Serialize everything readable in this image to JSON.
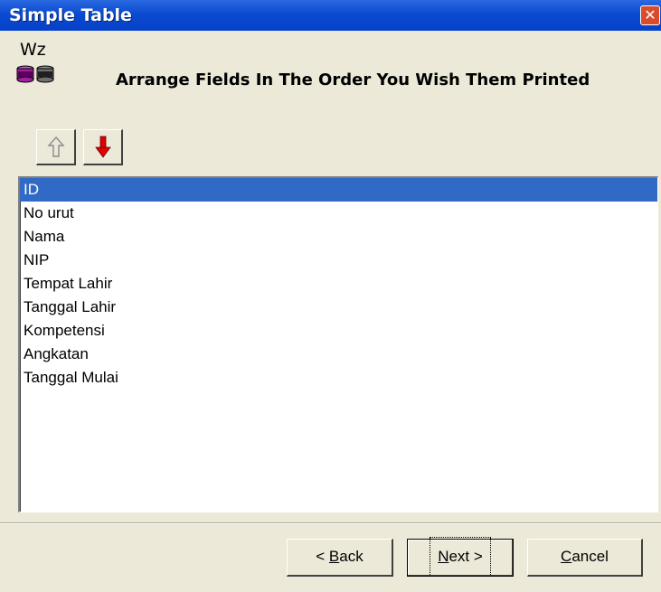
{
  "window": {
    "title": "Simple Table",
    "close_symbol": "✕"
  },
  "header": {
    "wz_label": "Wz",
    "icon": "view-abc-wizard-icon",
    "title": "Arrange Fields In The Order You Wish Them Printed"
  },
  "toolbar": {
    "move_up_icon": "arrow-up-outline-icon",
    "move_down_icon": "arrow-down-red-icon"
  },
  "fields": {
    "selected_index": 0,
    "items": [
      "ID",
      "No urut",
      "Nama",
      "NIP",
      "Tempat Lahir",
      "Tanggal Lahir",
      "Kompetensi",
      "Angkatan",
      "Tanggal Mulai"
    ]
  },
  "buttons": {
    "back": {
      "pre": "< ",
      "mnemonic": "B",
      "post": "ack"
    },
    "next": {
      "pre": "",
      "mnemonic": "N",
      "post": "ext >"
    },
    "cancel": {
      "pre": "",
      "mnemonic": "C",
      "post": "ancel"
    }
  },
  "colors": {
    "titlebar": "#0a4bd1",
    "selection": "#316ac5",
    "down_arrow": "#e00000",
    "dialog_bg": "#ece9d8"
  }
}
